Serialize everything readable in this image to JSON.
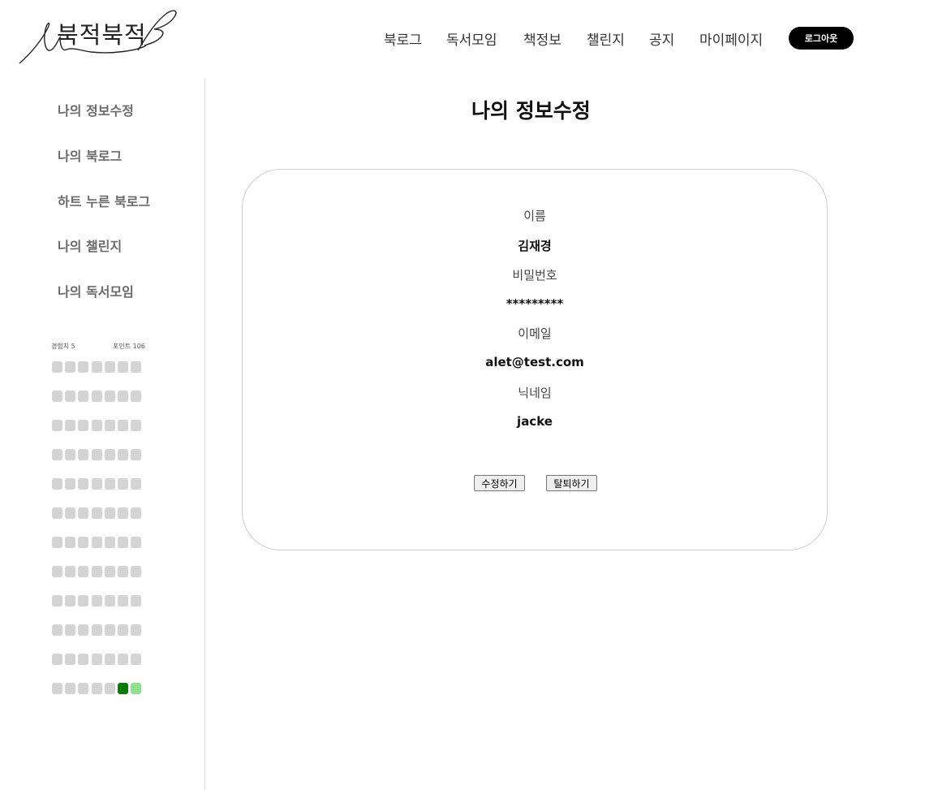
{
  "brand": {
    "logo_text": "북적북적"
  },
  "nav": {
    "items": [
      "북로그",
      "독서모임",
      "책정보",
      "챌린지",
      "공지",
      "마이페이지"
    ],
    "logout_label": "로그아웃"
  },
  "sidebar": {
    "items": [
      "나의 정보수정",
      "나의 북로그",
      "하트 누른 북로그",
      "나의 챌린지",
      "나의 독서모임"
    ],
    "experience_label": "경험치 5",
    "points_label": "포인트 106",
    "activity": {
      "rows": 12,
      "cols": 7,
      "empty_color": "#d4d4d4",
      "active_cells": [
        {
          "row": 11,
          "col": 5,
          "color": "#0a7a0a"
        },
        {
          "row": 11,
          "col": 6,
          "color": "#8fe08f"
        }
      ]
    }
  },
  "main": {
    "title": "나의 정보수정",
    "fields": [
      {
        "label": "이름",
        "value": "김재경"
      },
      {
        "label": "비밀번호",
        "value": "*********"
      },
      {
        "label": "이메일",
        "value": "alet@test.com"
      },
      {
        "label": "닉네임",
        "value": "jacke"
      }
    ],
    "buttons": {
      "edit": "수정하기",
      "withdraw": "탈퇴하기"
    }
  }
}
